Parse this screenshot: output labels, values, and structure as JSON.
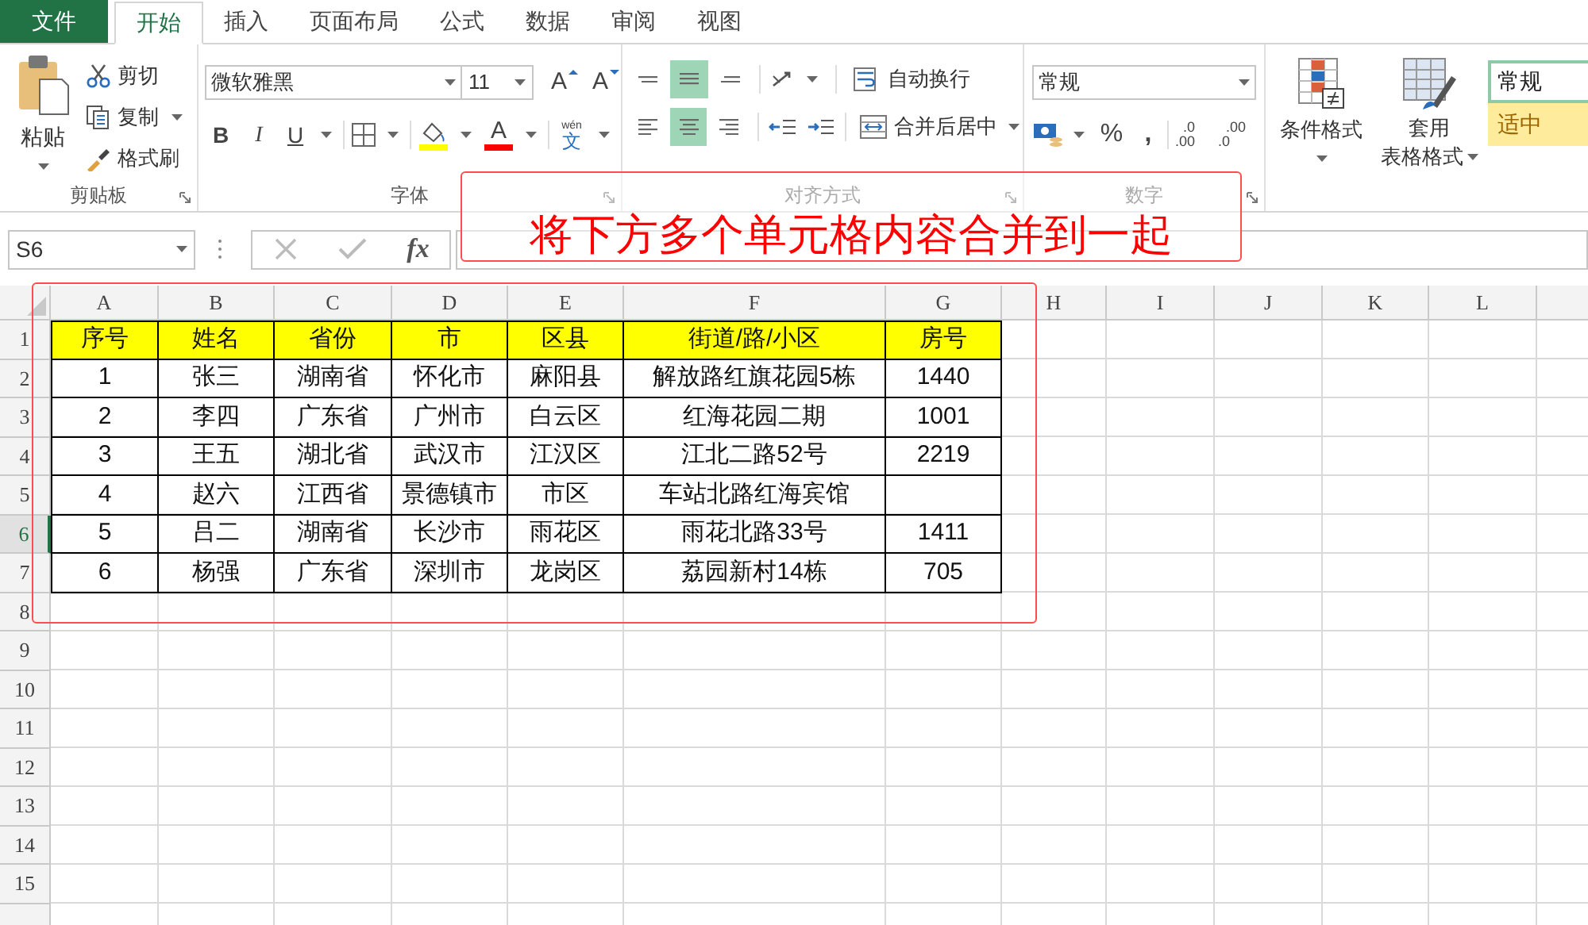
{
  "tabs": [
    {
      "label": "文件",
      "kind": "file",
      "selected": false
    },
    {
      "label": "开始",
      "kind": "tab",
      "selected": true
    },
    {
      "label": "插入",
      "kind": "tab",
      "selected": false
    },
    {
      "label": "页面布局",
      "kind": "tab",
      "selected": false
    },
    {
      "label": "公式",
      "kind": "tab",
      "selected": false
    },
    {
      "label": "数据",
      "kind": "tab",
      "selected": false
    },
    {
      "label": "审阅",
      "kind": "tab",
      "selected": false
    },
    {
      "label": "视图",
      "kind": "tab",
      "selected": false
    }
  ],
  "clipboard": {
    "paste": "粘贴",
    "cut": "剪切",
    "copy": "复制",
    "format_painter": "格式刷",
    "label": "剪贴板"
  },
  "font": {
    "name": "微软雅黑",
    "size": "11",
    "grow": "A",
    "shrink": "A",
    "bold": "B",
    "italic": "I",
    "underline": "U",
    "font_color": "A",
    "phonetic_top": "wén",
    "phonetic": "文",
    "label": "字体"
  },
  "alignment": {
    "vertical": [
      {
        "kind": "top",
        "selected": false
      },
      {
        "kind": "middle",
        "selected": true
      },
      {
        "kind": "bottom",
        "selected": false
      }
    ],
    "horizontal": [
      {
        "kind": "left",
        "selected": false
      },
      {
        "kind": "center",
        "selected": true
      },
      {
        "kind": "right",
        "selected": false
      }
    ],
    "wrap": "自动换行",
    "merge": "合并后居中",
    "label": "对齐方式"
  },
  "number": {
    "format": "常规",
    "percent": "%",
    "comma": ",",
    "increase_decimal": [
      ".0",
      ".00"
    ],
    "decrease_decimal": [
      ".00",
      ".0"
    ],
    "label": "数字"
  },
  "styles": {
    "conditional": "条件格式",
    "table_format": [
      "套用",
      "表格格式"
    ],
    "gallery": [
      {
        "label": "常规",
        "kind": "normal"
      },
      {
        "label": "适中",
        "kind": "neutral"
      }
    ]
  },
  "formula_bar": {
    "name_box": "S6",
    "fx": "fx"
  },
  "annotation": "将下方多个单元格内容合并到一起",
  "sheet": {
    "columns": [
      "A",
      "B",
      "C",
      "D",
      "E",
      "F",
      "G",
      "H",
      "I",
      "J",
      "K",
      "L"
    ],
    "rows": [
      {
        "label": "1",
        "selected": false
      },
      {
        "label": "2",
        "selected": false
      },
      {
        "label": "3",
        "selected": false
      },
      {
        "label": "4",
        "selected": false
      },
      {
        "label": "5",
        "selected": false
      },
      {
        "label": "6",
        "selected": true
      },
      {
        "label": "7",
        "selected": false
      },
      {
        "label": "8",
        "selected": false
      },
      {
        "label": "9",
        "selected": false
      },
      {
        "label": "10",
        "selected": false
      },
      {
        "label": "11",
        "selected": false
      },
      {
        "label": "12",
        "selected": false
      },
      {
        "label": "13",
        "selected": false
      },
      {
        "label": "14",
        "selected": false
      },
      {
        "label": "15",
        "selected": false
      }
    ],
    "table": {
      "header": [
        "序号",
        "姓名",
        "省份",
        "市",
        "区县",
        "街道/路/小区",
        "房号"
      ],
      "rows": [
        {
          "no": "1",
          "name": "张三",
          "province": "湖南省",
          "city": "怀化市",
          "district": "麻阳县",
          "street": "解放路红旗花园5栋",
          "room": "1440"
        },
        {
          "no": "2",
          "name": "李四",
          "province": "广东省",
          "city": "广州市",
          "district": "白云区",
          "street": "红海花园二期",
          "room": "1001"
        },
        {
          "no": "3",
          "name": "王五",
          "province": "湖北省",
          "city": "武汉市",
          "district": "江汉区",
          "street": "江北二路52号",
          "room": "2219"
        },
        {
          "no": "4",
          "name": "赵六",
          "province": "江西省",
          "city": "景德镇市",
          "district": "市区",
          "street": "车站北路红海宾馆"
        },
        {
          "no": "5",
          "name": "吕二",
          "province": "湖南省",
          "city": "长沙市",
          "district": "雨花区",
          "street": "雨花北路33号",
          "room": "1411"
        },
        {
          "no": "6",
          "name": "杨强",
          "province": "广东省",
          "city": "深圳市",
          "district": "龙岗区",
          "street": "荔园新村14栋",
          "room": "705"
        }
      ]
    }
  }
}
